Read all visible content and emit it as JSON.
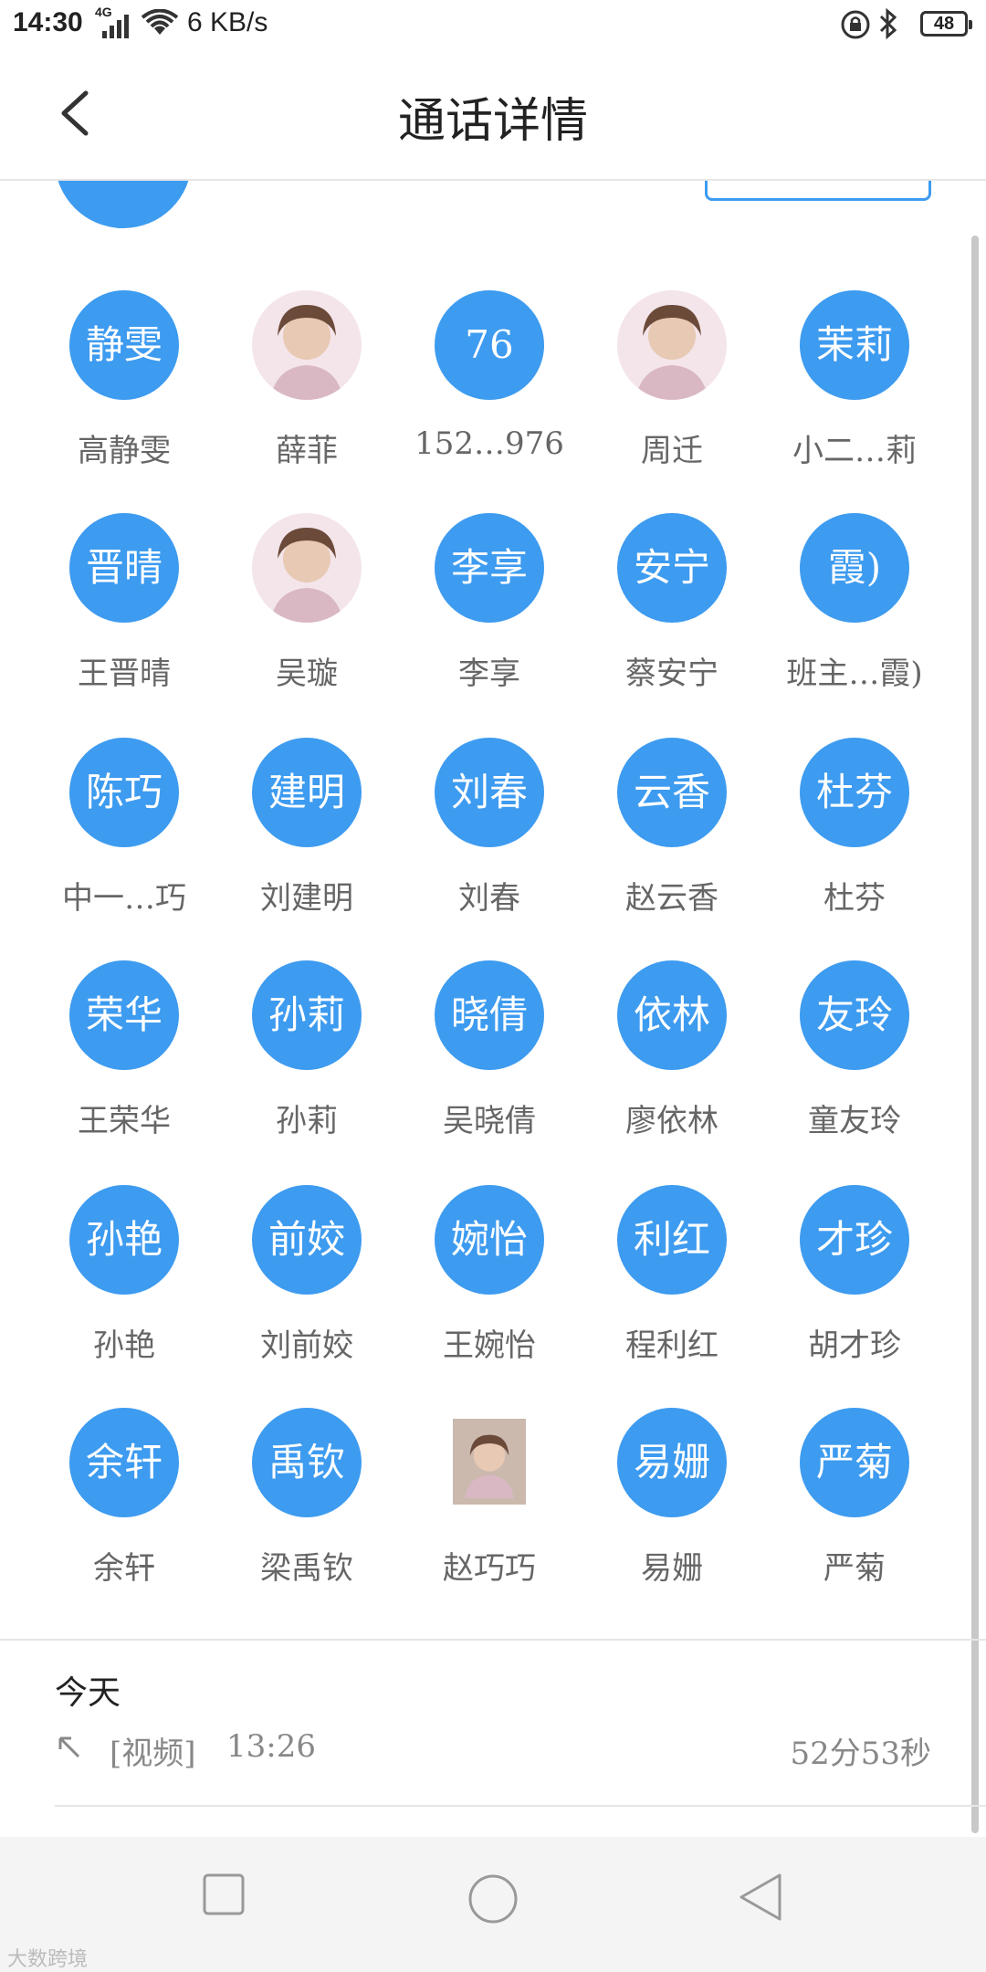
{
  "status_bar": {
    "time": "14:30",
    "network": "4G",
    "speed": "6 KB/s",
    "battery": "48"
  },
  "header": {
    "title": "通话详情"
  },
  "contacts": [
    {
      "avatar_text": "静雯",
      "name": "高静雯"
    },
    {
      "avatar_text": "",
      "name": "薛菲",
      "photo": true
    },
    {
      "avatar_text": "76",
      "name": "152…976"
    },
    {
      "avatar_text": "",
      "name": "周迁",
      "photo": true
    },
    {
      "avatar_text": "茉莉",
      "name": "小二…莉"
    },
    {
      "avatar_text": "晋晴",
      "name": "王晋晴"
    },
    {
      "avatar_text": "",
      "name": "吴璇",
      "photo": true
    },
    {
      "avatar_text": "李享",
      "name": "李享"
    },
    {
      "avatar_text": "安宁",
      "name": "蔡安宁"
    },
    {
      "avatar_text": "霞)",
      "name": "班主…霞)"
    },
    {
      "avatar_text": "陈巧",
      "name": "中一…巧"
    },
    {
      "avatar_text": "建明",
      "name": "刘建明"
    },
    {
      "avatar_text": "刘春",
      "name": "刘春"
    },
    {
      "avatar_text": "云香",
      "name": "赵云香"
    },
    {
      "avatar_text": "杜芬",
      "name": "杜芬"
    },
    {
      "avatar_text": "荣华",
      "name": "王荣华"
    },
    {
      "avatar_text": "孙莉",
      "name": "孙莉"
    },
    {
      "avatar_text": "晓倩",
      "name": "吴晓倩"
    },
    {
      "avatar_text": "依林",
      "name": "廖依林"
    },
    {
      "avatar_text": "友玲",
      "name": "童友玲"
    },
    {
      "avatar_text": "孙艳",
      "name": "孙艳"
    },
    {
      "avatar_text": "前姣",
      "name": "刘前姣"
    },
    {
      "avatar_text": "婉怡",
      "name": "王婉怡"
    },
    {
      "avatar_text": "利红",
      "name": "程利红"
    },
    {
      "avatar_text": "才珍",
      "name": "胡才珍"
    },
    {
      "avatar_text": "余轩",
      "name": "余轩"
    },
    {
      "avatar_text": "禹钦",
      "name": "梁禹钦"
    },
    {
      "avatar_text": "",
      "name": "赵巧巧",
      "photo": true,
      "square": true
    },
    {
      "avatar_text": "易姗",
      "name": "易姗"
    },
    {
      "avatar_text": "严菊",
      "name": "严菊"
    }
  ],
  "call_log": {
    "date": "今天",
    "type": "[视频]",
    "time": "13:26",
    "duration": "52分53秒"
  },
  "watermark": "大数跨境",
  "colors": {
    "accent": "#3d9bf0"
  }
}
